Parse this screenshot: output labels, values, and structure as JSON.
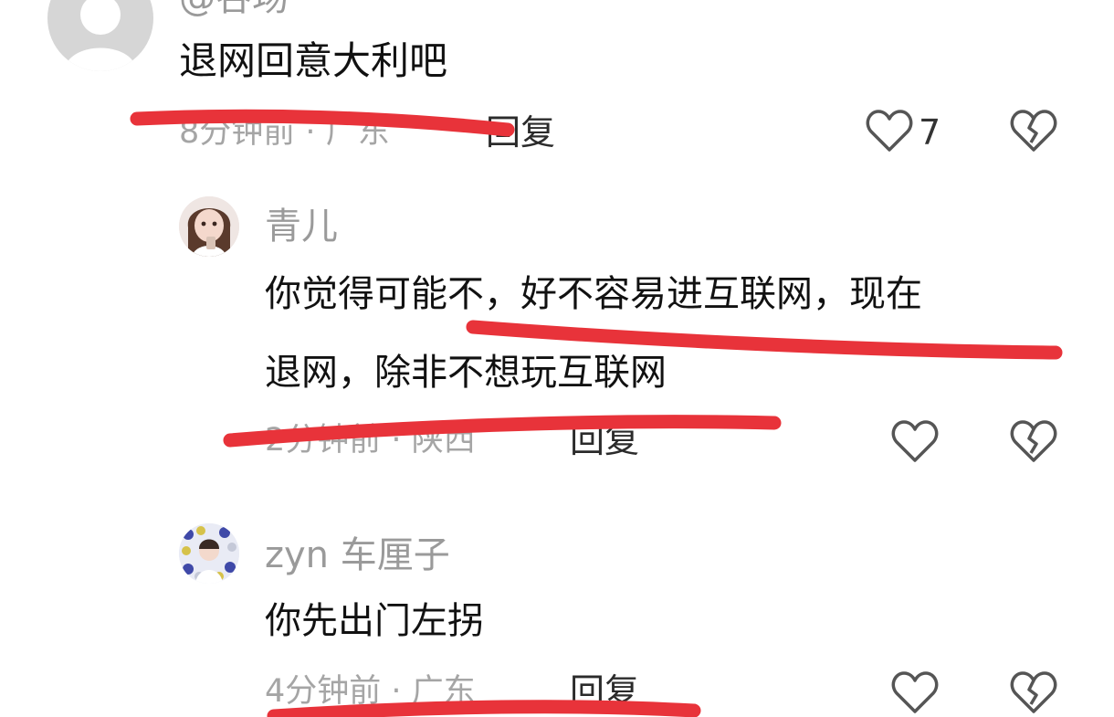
{
  "comments": [
    {
      "username": "@谷场",
      "text": "退网回意大利吧",
      "time": "8分钟前",
      "location": "广东",
      "reply_label": "回复",
      "like_count": "7"
    },
    {
      "username": "青儿",
      "text_line1": "你觉得可能不，好不容易进互联网，现在",
      "text_line2": "退网，除非不想玩互联网",
      "time": "2分钟前",
      "location": "陕西",
      "reply_label": "回复"
    },
    {
      "username": "zyn 车厘子",
      "text": "你先出门左拐",
      "time": "4分钟前",
      "location": "广东",
      "reply_label": "回复"
    }
  ],
  "colors": {
    "underline_mark": "#e8333a",
    "username": "#9a9a9a",
    "meta": "#a5a5a5"
  },
  "icons": [
    "avatar-icon",
    "heart-icon",
    "broken-heart-icon"
  ]
}
